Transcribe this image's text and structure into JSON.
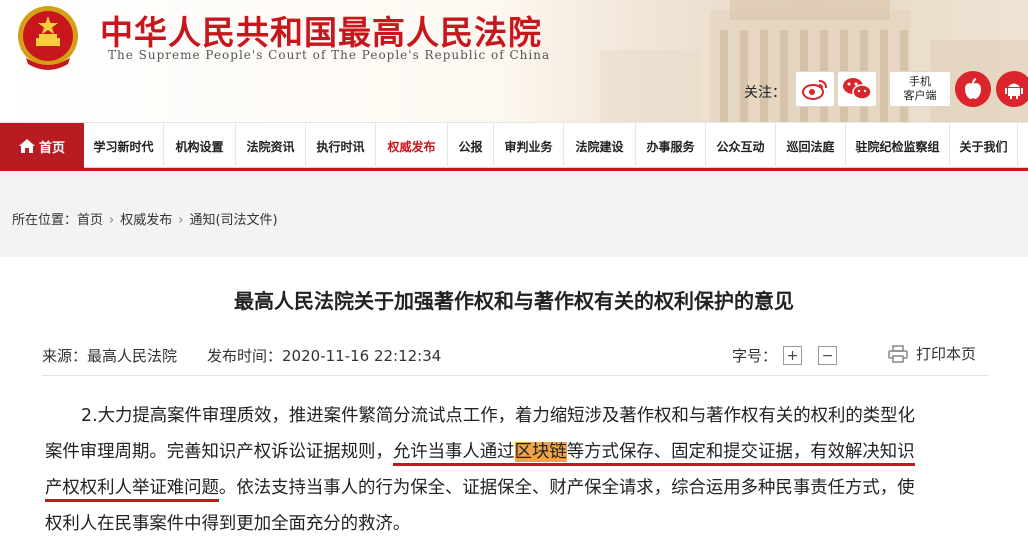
{
  "header": {
    "title": "中华人民共和国最高人民法院",
    "subtitle": "The Supreme People's Court of The People's Republic of China",
    "follow_label": "关注：",
    "social": [
      {
        "name": "weibo-icon"
      },
      {
        "name": "wechat-icon"
      }
    ],
    "mobile_label_line1": "手机",
    "mobile_label_line2": "客户端",
    "apps": [
      {
        "name": "apple-icon"
      },
      {
        "name": "android-icon"
      }
    ]
  },
  "nav": {
    "home": "首页",
    "items": [
      {
        "label": "学习新时代"
      },
      {
        "label": "机构设置"
      },
      {
        "label": "法院资讯"
      },
      {
        "label": "执行时讯"
      },
      {
        "label": "权威发布",
        "active": true
      },
      {
        "label": "公报"
      },
      {
        "label": "审判业务"
      },
      {
        "label": "法院建设"
      },
      {
        "label": "办事服务"
      },
      {
        "label": "公众互动"
      },
      {
        "label": "巡回法庭"
      },
      {
        "label": "驻院纪检监察组"
      },
      {
        "label": "关于我们"
      }
    ]
  },
  "breadcrumb": {
    "prefix": "所在位置：",
    "items": [
      "首页",
      "权威发布",
      "通知(司法文件)"
    ]
  },
  "article": {
    "title": "最高人民法院关于加强著作权和与著作权有关的权利保护的意见",
    "source": "来源：最高人民法院",
    "published": "发布时间：2020-11-16 22:12:34",
    "fontsize_label": "字号：",
    "fontsize_plus": "+",
    "fontsize_minus": "−",
    "print_label": "打印本页",
    "paragraph": {
      "line1": "2.大力提高案件审理质效，推进案件繁简分流试点工作，着力缩短涉及著作权和与著作权有关的权利的类型化",
      "line2_a": "案件审理周期。完善知识产权诉讼证据规则，",
      "line2_b": "允许当事人通过",
      "line2_c": "区块链",
      "line2_d": "等方式保存、固定和提交证据，有效解决知识",
      "line3_a": "产权权利人举证难问题",
      "line3_b": "。依法支持当事人的行为保全、证据保全、财产保全请求，综合运用多种民事责任方式，使",
      "line4": "权利人在民事案件中得到更加全面充分的救济。"
    }
  },
  "colors": {
    "brand_red": "#c8161d",
    "highlight": "#f0a44a"
  }
}
